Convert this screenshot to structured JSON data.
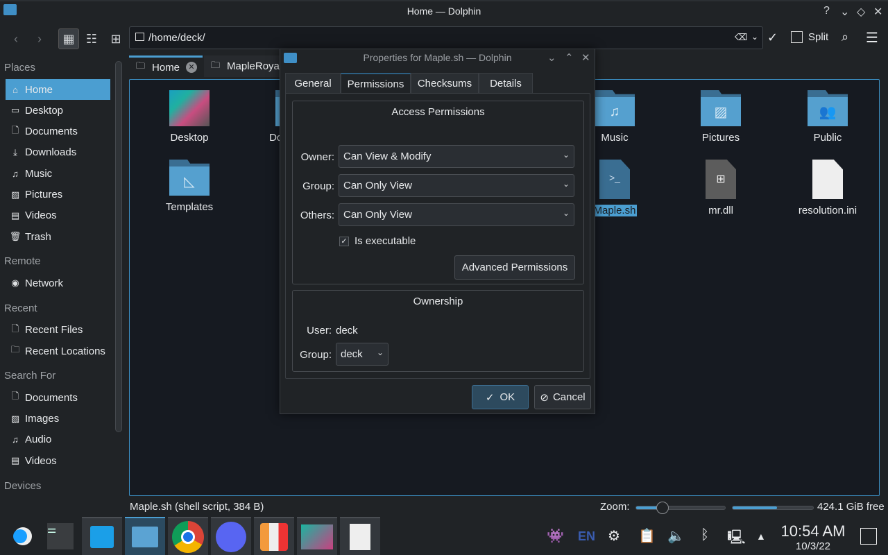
{
  "window": {
    "title": "Home — Dolphin",
    "help_icon": "?",
    "minimize_icon": "⌄",
    "maximize_icon": "◇",
    "close_icon": "✕"
  },
  "toolbar": {
    "path": "/home/deck/",
    "split_label": "Split"
  },
  "sidebar": {
    "sections": [
      {
        "title": "Places",
        "items": [
          {
            "label": "Home",
            "icon": "home-icon",
            "active": true
          },
          {
            "label": "Desktop",
            "icon": "desktop-icon"
          },
          {
            "label": "Documents",
            "icon": "documents-icon"
          },
          {
            "label": "Downloads",
            "icon": "downloads-icon"
          },
          {
            "label": "Music",
            "icon": "music-icon"
          },
          {
            "label": "Pictures",
            "icon": "pictures-icon"
          },
          {
            "label": "Videos",
            "icon": "videos-icon"
          },
          {
            "label": "Trash",
            "icon": "trash-icon"
          }
        ]
      },
      {
        "title": "Remote",
        "items": [
          {
            "label": "Network",
            "icon": "network-icon"
          }
        ]
      },
      {
        "title": "Recent",
        "items": [
          {
            "label": "Recent Files",
            "icon": "recent-files-icon"
          },
          {
            "label": "Recent Locations",
            "icon": "recent-locations-icon"
          }
        ]
      },
      {
        "title": "Search For",
        "items": [
          {
            "label": "Documents",
            "icon": "documents-icon"
          },
          {
            "label": "Images",
            "icon": "images-icon"
          },
          {
            "label": "Audio",
            "icon": "audio-icon"
          },
          {
            "label": "Videos",
            "icon": "videos-icon"
          }
        ]
      },
      {
        "title": "Devices",
        "items": []
      }
    ]
  },
  "tabs": [
    {
      "label": "Home",
      "active": true
    },
    {
      "label": "MapleRoyals"
    }
  ],
  "files": [
    {
      "name": "Desktop",
      "type": "desktop"
    },
    {
      "name": "Documents",
      "type": "folder"
    },
    {
      "name": "Music",
      "type": "folder-music"
    },
    {
      "name": "Pictures",
      "type": "folder-pictures"
    },
    {
      "name": "Public",
      "type": "folder-public"
    },
    {
      "name": "Templates",
      "type": "folder-templates"
    },
    {
      "name": "Maple.sh",
      "type": "shell-script",
      "selected": true
    },
    {
      "name": "mr.dll",
      "type": "dll"
    },
    {
      "name": "resolution.ini",
      "type": "text"
    }
  ],
  "statusbar": {
    "selection": "Maple.sh (shell script, 384 B)",
    "zoom_label": "Zoom:",
    "zoom_level": 0.3,
    "disk_used_fraction": 0.55,
    "free_space": "424.1 GiB free"
  },
  "dialog": {
    "title": "Properties for Maple.sh — Dolphin",
    "tabs": [
      "General",
      "Permissions",
      "Checksums",
      "Details"
    ],
    "active_tab": "Permissions",
    "access": {
      "title": "Access Permissions",
      "owner_label": "Owner:",
      "owner_value": "Can View & Modify",
      "group_label": "Group:",
      "group_value": "Can Only View",
      "others_label": "Others:",
      "others_value": "Can Only View",
      "executable_label": "Is executable",
      "executable_checked": true,
      "advanced_label": "Advanced Permissions"
    },
    "ownership": {
      "title": "Ownership",
      "user_label": "User:",
      "user_value": "deck",
      "group_label": "Group:",
      "group_value": "deck"
    },
    "ok_label": "OK",
    "cancel_label": "Cancel"
  },
  "taskbar": {
    "apps": [
      "steam-deck-menu",
      "system-settings",
      "discover",
      "dolphin",
      "chrome",
      "discord",
      "protonup",
      "screenshot",
      "text-editor"
    ],
    "tray": {
      "lang": "EN",
      "time": "10:54 AM",
      "date": "10/3/22"
    }
  },
  "colors": {
    "accent": "#4b9ed1",
    "folder": "#55a0cf",
    "background": "#202326",
    "view": "#161a21"
  }
}
